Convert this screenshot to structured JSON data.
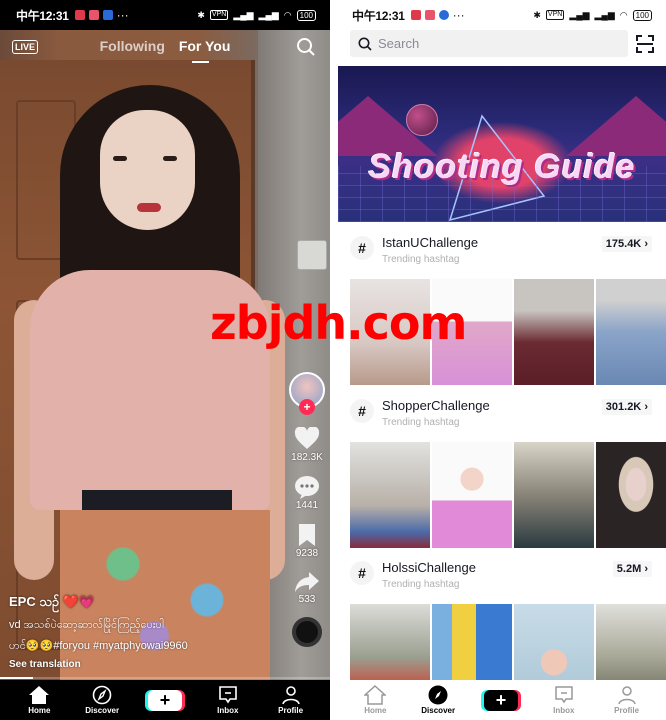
{
  "status_bar": {
    "time": "中午12:31",
    "vpn_label": "VPN",
    "signal_label": "HD",
    "battery": "100"
  },
  "feed": {
    "live_label": "LIVE",
    "tabs": [
      {
        "label": "Following",
        "active": false
      },
      {
        "label": "For You",
        "active": true
      }
    ],
    "rail": {
      "like_count": "182.3K",
      "comment_count": "1441",
      "bookmark_count": "9238",
      "share_count": "533"
    },
    "caption": {
      "author": "EPC သဉ် ❤️💗",
      "description_line1": "vd အသစ်ပဲဆော့ဆာလ်မြိုင်ကြည့်ပေးပါ",
      "description_line2": "ဟင်🥺🥺#foryou #myatphyowai9960",
      "see_translation": "See translation"
    },
    "progress_percent": 10,
    "bottom_nav": [
      {
        "label": "Home",
        "active": true
      },
      {
        "label": "Discover",
        "active": false
      },
      {
        "label": "",
        "active": false
      },
      {
        "label": "Inbox",
        "active": false
      },
      {
        "label": "Profile",
        "active": false
      }
    ]
  },
  "discover": {
    "search_placeholder": "Search",
    "banner_title": "Shooting Guide",
    "hashtags": [
      {
        "name": "IstanUChallenge",
        "subtitle": "Trending hashtag",
        "count": "175.4K"
      },
      {
        "name": "ShopperChallenge",
        "subtitle": "Trending hashtag",
        "count": "301.2K"
      },
      {
        "name": "HolssiChallenge",
        "subtitle": "Trending hashtag",
        "count": "5.2M"
      }
    ],
    "bottom_nav": [
      {
        "label": "Home",
        "active": false
      },
      {
        "label": "Discover",
        "active": true
      },
      {
        "label": "",
        "active": false
      },
      {
        "label": "Inbox",
        "active": false
      },
      {
        "label": "Profile",
        "active": false
      }
    ]
  },
  "watermark": "zbjdh.com",
  "colors": {
    "brand_red": "#fe2c55",
    "brand_cyan": "#25f4ee",
    "watermark_red": "#ff0000"
  }
}
